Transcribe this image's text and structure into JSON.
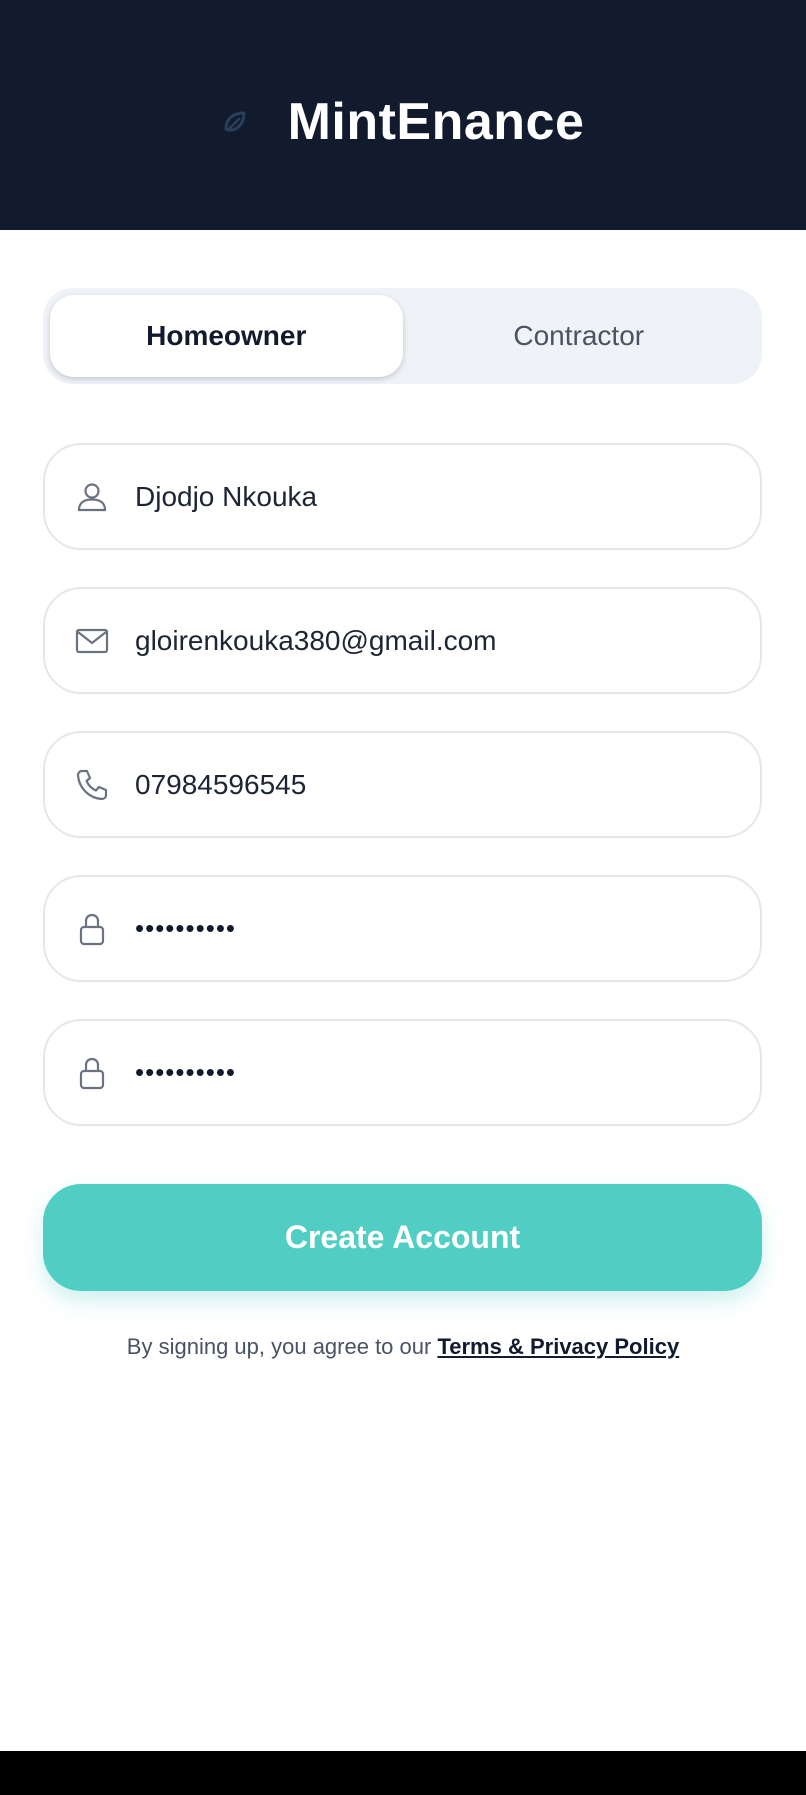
{
  "app": {
    "name": "MintEnance",
    "logo_icon": "leaf-logo-icon",
    "accent_color": "#51cec4",
    "header_color": "#121a2e"
  },
  "role_tabs": [
    {
      "label": "Homeowner",
      "selected": true
    },
    {
      "label": "Contractor",
      "selected": false
    }
  ],
  "form": {
    "name_field": {
      "value": "Djodjo Nkouka",
      "icon": "user-icon"
    },
    "email_field": {
      "value": "gloirenkouka380@gmail.com",
      "icon": "mail-icon"
    },
    "phone_field": {
      "value": "07984596545",
      "icon": "phone-icon"
    },
    "password_field": {
      "value": "••••••••••",
      "icon": "lock-icon"
    },
    "confirm_password_field": {
      "value": "••••••••••",
      "icon": "lock-icon"
    }
  },
  "submit_button": {
    "label": "Create Account"
  },
  "legal": {
    "prefix": "By signing up, you agree to our",
    "link_label": "Terms & Privacy Policy"
  }
}
